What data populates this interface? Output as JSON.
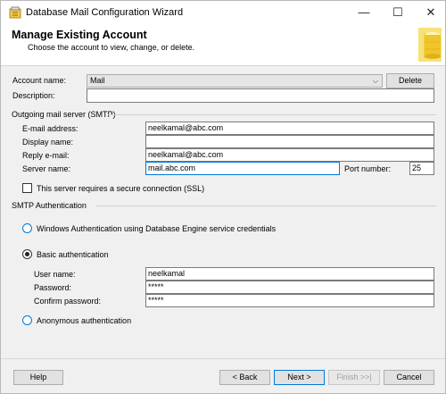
{
  "window": {
    "title": "Database Mail Configuration Wizard",
    "minimize_glyph": "—",
    "maximize_glyph": "☐",
    "close_glyph": "✕"
  },
  "header": {
    "title": "Manage Existing Account",
    "subtitle": "Choose the account to view, change, or delete."
  },
  "account": {
    "name_label": "Account name:",
    "name_value": "Mail",
    "delete_label": "Delete",
    "description_label": "Description:",
    "description_value": ""
  },
  "smtp": {
    "group_title": "Outgoing mail server (SMTP)",
    "email_label": "E-mail address:",
    "email_value": "neelkamal@abc.com",
    "display_label": "Display name:",
    "display_value": "",
    "reply_label": "Reply e-mail:",
    "reply_value": "neelkamal@abc.com",
    "server_label": "Server name:",
    "server_value": "mail.abc.com",
    "port_label": "Port number:",
    "port_value": "25",
    "ssl_label": "This server requires a secure connection (SSL)",
    "ssl_checked": false
  },
  "auth": {
    "group_title": "SMTP Authentication",
    "windows_label": "Windows Authentication using Database Engine service credentials",
    "basic_label": "Basic authentication",
    "username_label": "User name:",
    "username_value": "neelkamal",
    "password_label": "Password:",
    "password_value": "*****",
    "confirm_label": "Confirm password:",
    "confirm_value": "*****",
    "anonymous_label": "Anonymous authentication",
    "selected": "basic"
  },
  "footer": {
    "help": "Help",
    "back": "< Back",
    "next": "Next >",
    "finish": "Finish >>|",
    "cancel": "Cancel"
  },
  "colors": {
    "accent": "#0078d7",
    "window_bg": "#f0f0f0",
    "header_bg": "#ffffff"
  },
  "icons": [
    "app-icon",
    "minimize-icon",
    "maximize-icon",
    "close-icon",
    "chevron-down-icon",
    "wizard-header-icon"
  ]
}
